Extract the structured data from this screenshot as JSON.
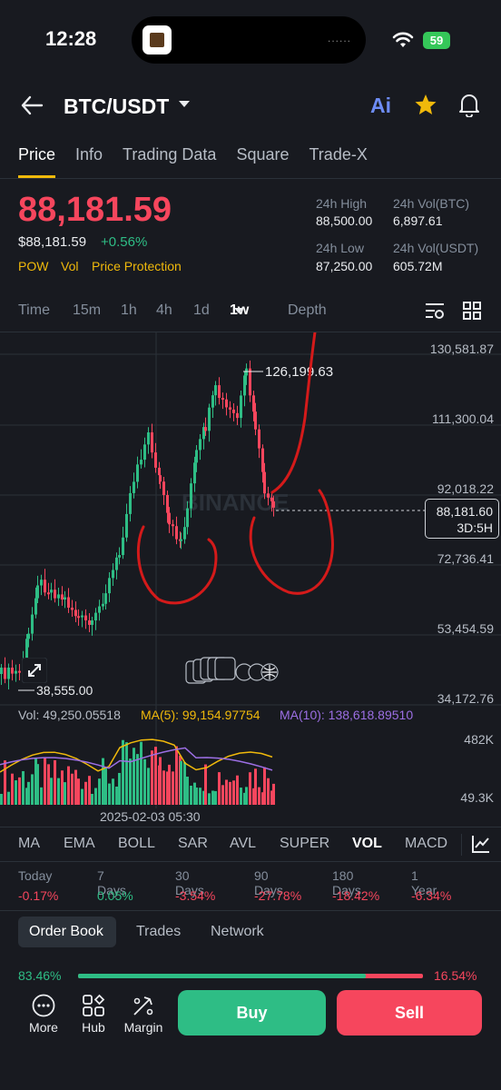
{
  "status_bar": {
    "time": "12:28",
    "battery": "59",
    "island_indicator": "......"
  },
  "header": {
    "pair": "BTC/USDT",
    "ai_label": "Ai",
    "icons": [
      "back-arrow-icon",
      "caret-down-icon",
      "star-icon",
      "bell-icon"
    ]
  },
  "tabs": [
    "Price",
    "Info",
    "Trading Data",
    "Square",
    "Trade-X"
  ],
  "ticker": {
    "last_price": "88,181.59",
    "usd_price": "$88,181.59",
    "change": "+0.56%",
    "tags": [
      "POW",
      "Vol",
      "Price Protection"
    ],
    "high_label": "24h High",
    "high_value": "88,500.00",
    "low_label": "24h Low",
    "low_value": "87,250.00",
    "vol_btc_label": "24h Vol(BTC)",
    "vol_btc_value": "6,897.61",
    "vol_usdt_label": "24h Vol(USDT)",
    "vol_usdt_value": "605.72M"
  },
  "timeframes": {
    "items": [
      "Time",
      "15m",
      "1h",
      "4h",
      "1d",
      "1w",
      "Depth"
    ],
    "selected": "1w"
  },
  "chart": {
    "y_axis": [
      "130,581.87",
      "111,300.04",
      "92,018.22",
      "72,736.41",
      "53,454.59",
      "34,172.76"
    ],
    "high_label": "126,199.63",
    "low_label": "38,555.00",
    "current_price_tag": "88,181.60",
    "countdown": "3D:5H",
    "watermark": "BINANCE",
    "volume_line": {
      "vol": "Vol: 49,250.05518",
      "ma5": "MA(5): 99,154.97754",
      "ma10": "MA(10): 138,618.89510"
    },
    "volume_axis": [
      "482K",
      "49.3K"
    ],
    "x_label": "2025-02-03 05:30",
    "colors": {
      "up": "#2ebd85",
      "down": "#f6465d",
      "ma5": "#f0b90b",
      "ma10": "#9c6fe4",
      "annotation": "#d41a1a"
    }
  },
  "indicators": [
    "MA",
    "EMA",
    "BOLL",
    "SAR",
    "AVL",
    "SUPER",
    "VOL",
    "MACD"
  ],
  "performance": [
    {
      "label": "Today",
      "value": "-0.17%"
    },
    {
      "label": "7 Days",
      "value": "0.05%"
    },
    {
      "label": "30 Days",
      "value": "-3.54%"
    },
    {
      "label": "90 Days",
      "value": "-27.78%"
    },
    {
      "label": "180 Days",
      "value": "-18.42%"
    },
    {
      "label": "1 Year",
      "value": "-6.34%"
    }
  ],
  "book_tabs": [
    "Order Book",
    "Trades",
    "Network"
  ],
  "order_book": {
    "bid_pct": "83.46%",
    "ask_pct": "16.54%",
    "bid_ratio": 0.8346
  },
  "bottom_nav": {
    "more": "More",
    "hub": "Hub",
    "margin": "Margin",
    "buy": "Buy",
    "sell": "Sell"
  }
}
